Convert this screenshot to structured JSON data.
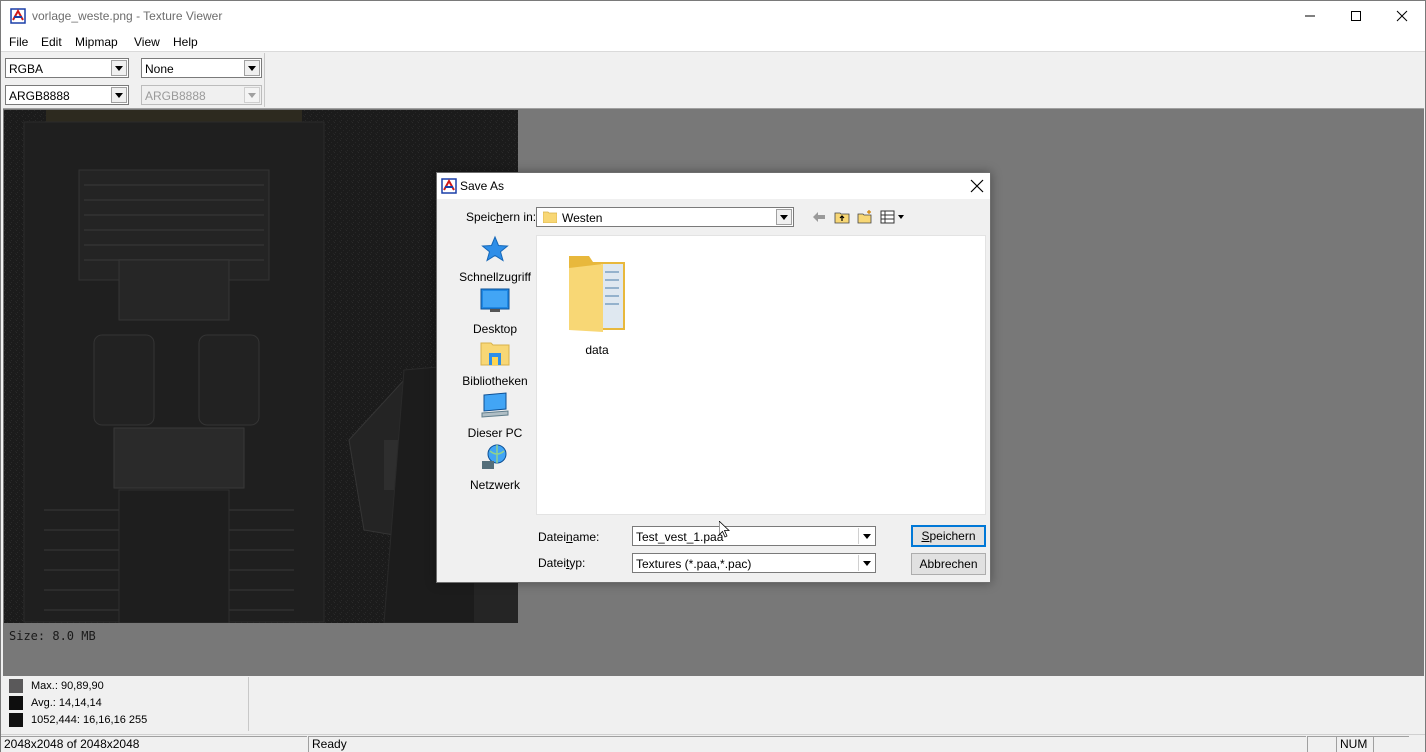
{
  "window": {
    "title": "vorlage_weste.png - Texture Viewer"
  },
  "menu": {
    "items": [
      "File",
      "Edit",
      "Mipmap",
      "View",
      "Help"
    ]
  },
  "toolbar": {
    "channel": "RGBA",
    "filter": "None",
    "source_format": "ARGB8888",
    "target_format": "ARGB8888"
  },
  "viewport": {
    "size_label": "Size: 8.0 MB"
  },
  "stats": {
    "rows": [
      {
        "text": "Max.: 90,89,90",
        "color": "#5a595a"
      },
      {
        "text": "Avg.: 14,14,14",
        "color": "#0e0e0e"
      },
      {
        "text": "1052,444: 16,16,16  255",
        "color": "#101010"
      }
    ]
  },
  "statusbar": {
    "dimensions": "2048x2048 of 2048x2048",
    "status": "Ready",
    "num": "NUM"
  },
  "dialog": {
    "title": "Save As",
    "lookin_label_pre": "Speic",
    "lookin_label_accel": "h",
    "lookin_label_post": "ern in:",
    "lookin_value": "Westen",
    "places": [
      {
        "label": "Schnellzugriff",
        "icon": "star-icon"
      },
      {
        "label": "Desktop",
        "icon": "desktop-icon"
      },
      {
        "label": "Bibliotheken",
        "icon": "libraries-icon"
      },
      {
        "label": "Dieser PC",
        "icon": "computer-icon"
      },
      {
        "label": "Netzwerk",
        "icon": "network-icon"
      }
    ],
    "files": [
      {
        "name": "data",
        "icon": "folder-icon"
      }
    ],
    "filename_label_pre": "Datei",
    "filename_label_accel": "n",
    "filename_label_post": "ame:",
    "filename_value": "Test_vest_1.paa",
    "filetype_label_pre": "Datei",
    "filetype_label_accel": "t",
    "filetype_label_post": "yp:",
    "filetype_value": "Textures (*.paa,*.pac)",
    "save_pre": "",
    "save_accel": "S",
    "save_post": "peichern",
    "cancel_label": "Abbrechen"
  }
}
